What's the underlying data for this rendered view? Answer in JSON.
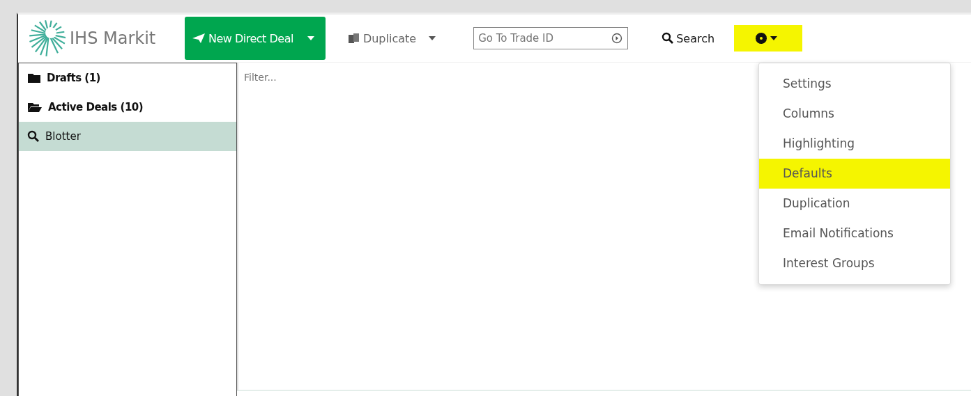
{
  "logo": {
    "text": "IHS Markit"
  },
  "toolbar": {
    "new_deal": "New Direct Deal",
    "duplicate": "Duplicate",
    "trade_id": {
      "placeholder": "Go To Trade ID"
    },
    "search": "Search",
    "settings": {
      "highlighted": true
    }
  },
  "sidebar": {
    "items": [
      {
        "label": "Drafts (1)",
        "kind": "folder",
        "selected": false
      },
      {
        "label": "Active Deals (10)",
        "kind": "open-folder",
        "selected": false
      },
      {
        "label": "Blotter",
        "kind": "search",
        "selected": true
      }
    ]
  },
  "filter": {
    "placeholder": "Filter..."
  },
  "menu": {
    "items": [
      {
        "label": "Settings",
        "highlighted": false
      },
      {
        "label": "Columns",
        "highlighted": false
      },
      {
        "label": "Highlighting",
        "highlighted": false
      },
      {
        "label": "Defaults",
        "highlighted": true
      },
      {
        "label": "Duplication",
        "highlighted": false
      },
      {
        "label": "Email Notifications",
        "highlighted": false
      },
      {
        "label": "Interest Groups",
        "highlighted": false
      }
    ]
  }
}
